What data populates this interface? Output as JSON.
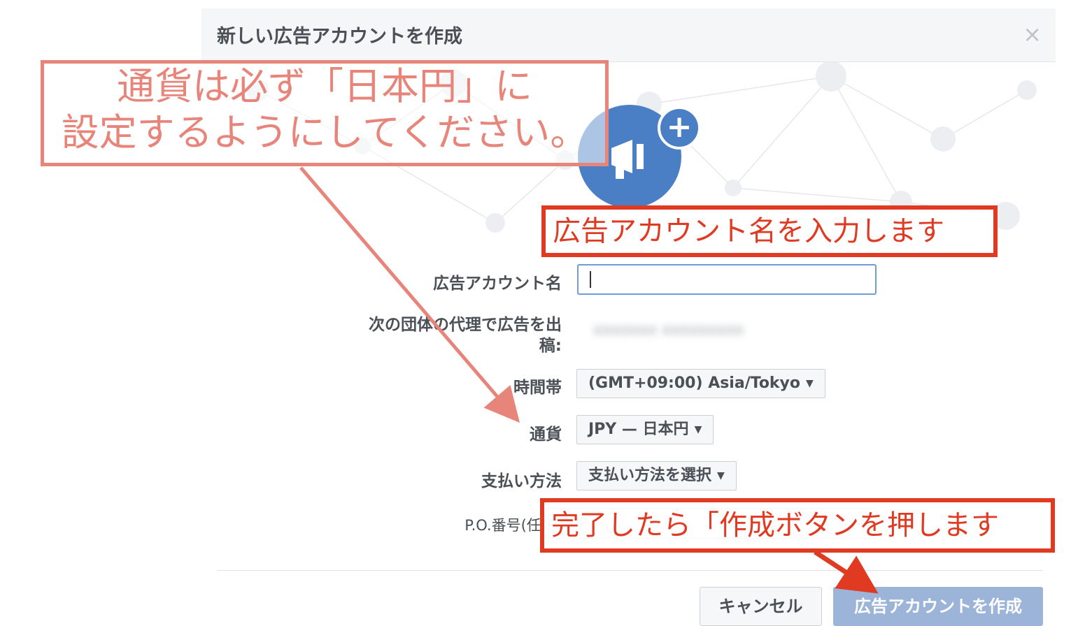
{
  "dialog": {
    "title": "新しい広告アカウントを作成",
    "close_symbol": "×"
  },
  "form": {
    "account_name_label": "広告アカウント名",
    "account_name_value": "",
    "advertise_for_label_line1": "次の団体の代理で広告を出",
    "advertise_for_label_line2": "稿:",
    "advertise_for_value": "xxxxxxx xxxxxxxxx",
    "timezone_label": "時間帯",
    "timezone_value": "(GMT+09:00) Asia/Tokyo",
    "currency_label": "通貨",
    "currency_value": "JPY — 日本円",
    "payment_label": "支払い方法",
    "payment_value": "支払い方法を選択",
    "po_label": "P.O.番号(任意)",
    "po_value": ""
  },
  "buttons": {
    "cancel": "キャンセル",
    "create": "広告アカウントを作成"
  },
  "annotations": {
    "currency_note": "通貨は必ず「日本円」に\n設定するようにしてください。",
    "account_name_note": "広告アカウント名を入力します",
    "create_note": "完了したら「作成ボタンを押します"
  },
  "icons": {
    "avatar": "megaphone-icon",
    "plus": "plus-icon",
    "close": "close-icon",
    "dropdown": "chevron-down-icon"
  },
  "colors": {
    "pink_annotation": "#e8857a",
    "red_annotation": "#e03b22",
    "primary_blue": "#4a7fc6",
    "disabled_button": "#9cb4d8"
  }
}
